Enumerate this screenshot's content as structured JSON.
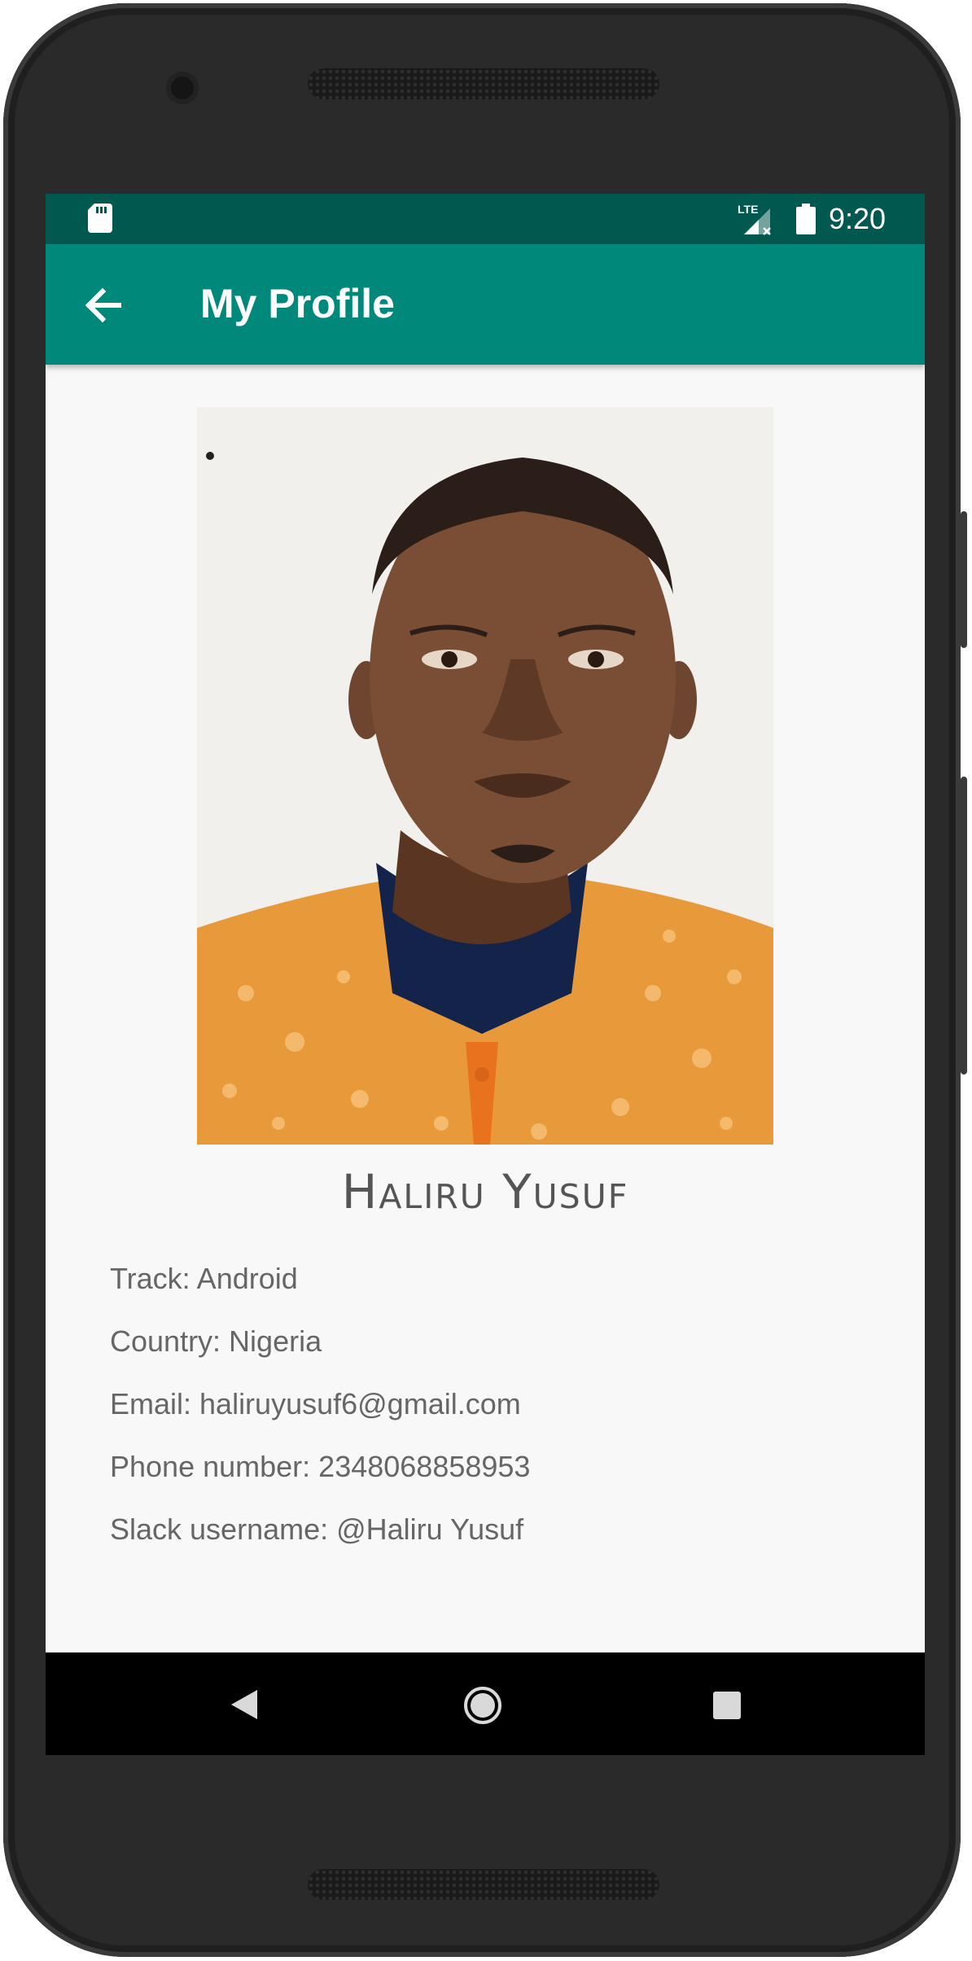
{
  "status_bar": {
    "time": "9:20",
    "network_label": "LTE",
    "icons": [
      "sd-card-icon",
      "lte-signal-icon",
      "battery-icon"
    ]
  },
  "app_bar": {
    "title": "My Profile",
    "back_icon": "arrow-back-icon",
    "color": "#00897b",
    "status_color": "#00584f"
  },
  "profile": {
    "photo": "profile-photo",
    "name": "Haliru Yusuf",
    "details": [
      "Track: Android",
      "Country: Nigeria",
      "Email: haliruyusuf6@gmail.com",
      "Phone number: 2348068858953",
      "Slack username: @Haliru Yusuf"
    ]
  },
  "nav_bar": {
    "icons": [
      "nav-back-icon",
      "nav-home-icon",
      "nav-recents-icon"
    ]
  }
}
